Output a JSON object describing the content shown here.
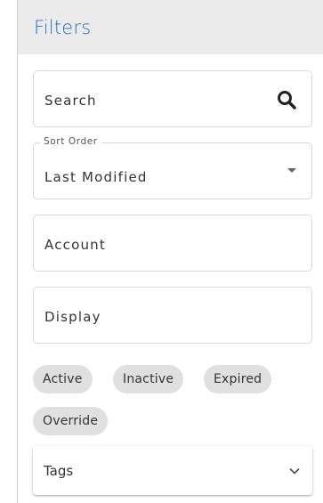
{
  "panel": {
    "title": "Filters"
  },
  "search": {
    "label": "Search",
    "icon": "search-icon"
  },
  "sort": {
    "legend": "Sort Order",
    "selected": "Last Modified",
    "icon": "caret-down-icon"
  },
  "account": {
    "label": "Account"
  },
  "display": {
    "label": "Display"
  },
  "status_chips": [
    "Active",
    "Inactive",
    "Expired",
    "Override"
  ],
  "tags": {
    "label": "Tags",
    "icon": "chevron-down-icon"
  },
  "colors": {
    "title": "#2a6ebb",
    "header_bg": "#ebebeb",
    "chip_bg": "#e0e0e0"
  }
}
